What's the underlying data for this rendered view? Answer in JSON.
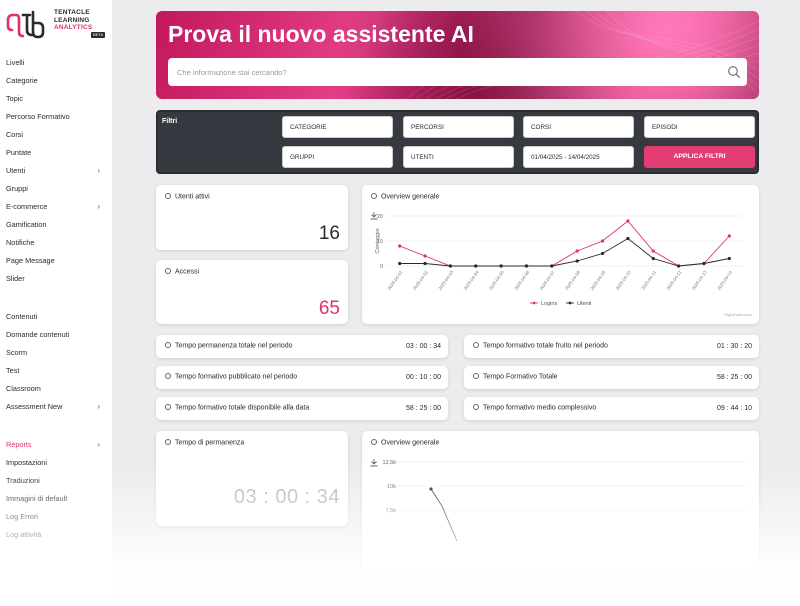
{
  "logo": {
    "line1": "TENTACLE",
    "line2": "LEARNING",
    "line3": "ANALYTICS",
    "badge": "BETA"
  },
  "sidebar": {
    "group1": [
      {
        "label": "Livelli"
      },
      {
        "label": "Categorie"
      },
      {
        "label": "Topic"
      },
      {
        "label": "Percorso Formativo"
      },
      {
        "label": "Corsi"
      },
      {
        "label": "Puntate"
      },
      {
        "label": "Utenti",
        "chevron": true
      },
      {
        "label": "Gruppi"
      },
      {
        "label": "E-commerce",
        "chevron": true
      },
      {
        "label": "Gamification"
      },
      {
        "label": "Notifiche"
      },
      {
        "label": "Page Message"
      },
      {
        "label": "Slider"
      }
    ],
    "group2": [
      {
        "label": "Contenuti"
      },
      {
        "label": "Domande contenuti"
      },
      {
        "label": "Scorm"
      },
      {
        "label": "Test"
      },
      {
        "label": "Classroom"
      },
      {
        "label": "Assessment New",
        "chevron": true
      }
    ],
    "group3": [
      {
        "label": "Reports",
        "chevron": true,
        "active": true
      },
      {
        "label": "Impostazioni"
      },
      {
        "label": "Traduzioni"
      },
      {
        "label": "Immagini di default"
      },
      {
        "label": "Log Errori"
      },
      {
        "label": "Log attività"
      }
    ]
  },
  "hero": {
    "title": "Prova il nuovo assistente AI",
    "search_placeholder": "Che informazione stai cercando?"
  },
  "filters": {
    "title": "Filtri",
    "fields": [
      "CATEGORIE",
      "PERCORSI",
      "CORSI",
      "EPISODI",
      "GRUPPI",
      "UTENTI",
      "01/04/2025 - 14/04/2025"
    ],
    "apply_label": "APPLICA FILTRI"
  },
  "kpi": {
    "active_users": {
      "title": "Utenti attivi",
      "value": "16"
    },
    "accesses": {
      "title": "Accessi",
      "value": "65"
    },
    "time_permanence": {
      "title": "Tempo di permanenza",
      "value": "03 : 00 : 34"
    }
  },
  "rows": [
    {
      "label": "Tempo permanenza totale nel periodo",
      "value": "03 : 00 : 34"
    },
    {
      "label": "Tempo formativo totale fruito nel periodo",
      "value": "01 : 30 : 20"
    },
    {
      "label": "Tempo formativo pubblicato nel periodo",
      "value": "00 : 10 : 00"
    },
    {
      "label": "Tempo Formativo Totale",
      "value": "58 : 25 : 00"
    },
    {
      "label": "Tempo formativo totale disponibile alla data",
      "value": "58 : 25 : 00"
    },
    {
      "label": "Tempo formativo medio complessivo",
      "value": "09 : 44 : 10"
    }
  ],
  "overview1": {
    "title": "Overview generale",
    "credit": "Highcharts.com"
  },
  "overview2": {
    "title": "Overview generale"
  },
  "chart_data": [
    {
      "type": "line",
      "title": "",
      "ylabel": "Conteggio",
      "ylim": [
        0,
        20
      ],
      "yticks": [
        0,
        10,
        20
      ],
      "x": [
        "2025-04-01",
        "2025-04-02",
        "2025-04-03",
        "2025-04-04",
        "2025-04-05",
        "2025-04-06",
        "2025-04-07",
        "2025-04-08",
        "2025-04-09",
        "2025-04-10",
        "2025-04-11",
        "2025-04-12",
        "2025-04-13",
        "2025-04-14"
      ],
      "series": [
        {
          "name": "Logins",
          "color": "#e0306e",
          "values": [
            8,
            4,
            0,
            0,
            0,
            0,
            0,
            6,
            10,
            18,
            6,
            0,
            1,
            12
          ]
        },
        {
          "name": "Utenti",
          "color": "#2a2a2e",
          "values": [
            1,
            1,
            0,
            0,
            0,
            0,
            0,
            2,
            5,
            11,
            3,
            0,
            1,
            3
          ]
        }
      ],
      "legend": "bottom"
    },
    {
      "type": "line",
      "title": "",
      "yticks": [
        "12,5k",
        "10k",
        "7,5k"
      ],
      "series": [
        {
          "name": "",
          "values": []
        }
      ]
    }
  ]
}
